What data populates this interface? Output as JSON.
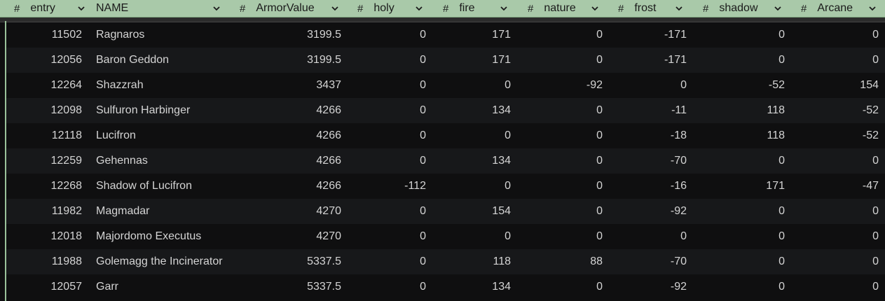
{
  "columns": [
    {
      "hash": "#",
      "label": "entry"
    },
    {
      "hash": "",
      "label": "NAME"
    },
    {
      "hash": "#",
      "label": "ArmorValue"
    },
    {
      "hash": "#",
      "label": "holy"
    },
    {
      "hash": "#",
      "label": "fire"
    },
    {
      "hash": "#",
      "label": "nature"
    },
    {
      "hash": "#",
      "label": "frost"
    },
    {
      "hash": "#",
      "label": "shadow"
    },
    {
      "hash": "#",
      "label": "Arcane"
    }
  ],
  "rows": [
    [
      "11502",
      "Ragnaros",
      "3199.5",
      "0",
      "171",
      "0",
      "-171",
      "0",
      "0"
    ],
    [
      "12056",
      "Baron Geddon",
      "3199.5",
      "0",
      "171",
      "0",
      "-171",
      "0",
      "0"
    ],
    [
      "12264",
      "Shazzrah",
      "3437",
      "0",
      "0",
      "-92",
      "0",
      "-52",
      "154"
    ],
    [
      "12098",
      "Sulfuron Harbinger",
      "4266",
      "0",
      "134",
      "0",
      "-11",
      "118",
      "-52"
    ],
    [
      "12118",
      "Lucifron",
      "4266",
      "0",
      "0",
      "0",
      "-18",
      "118",
      "-52"
    ],
    [
      "12259",
      "Gehennas",
      "4266",
      "0",
      "134",
      "0",
      "-70",
      "0",
      "0"
    ],
    [
      "12268",
      "Shadow of Lucifron",
      "4266",
      "-112",
      "0",
      "0",
      "-16",
      "171",
      "-47"
    ],
    [
      "11982",
      "Magmadar",
      "4270",
      "0",
      "154",
      "0",
      "-92",
      "0",
      "0"
    ],
    [
      "12018",
      "Majordomo Executus",
      "4270",
      "0",
      "0",
      "0",
      "0",
      "0",
      "0"
    ],
    [
      "11988",
      "Golemagg the Incinerator",
      "5337.5",
      "0",
      "118",
      "88",
      "-70",
      "0",
      "0"
    ],
    [
      "12057",
      "Garr",
      "5337.5",
      "0",
      "134",
      "0",
      "-92",
      "0",
      "0"
    ]
  ],
  "icons": {
    "header_sort": "chevron-down-icon"
  }
}
